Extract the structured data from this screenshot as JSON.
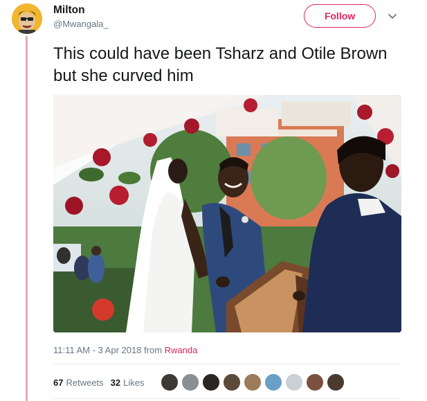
{
  "user": {
    "display_name": "Milton",
    "handle": "@Mwangala_"
  },
  "actions": {
    "follow_label": "Follow"
  },
  "tweet": {
    "text": "This could have been Tsharz and Otile Brown but she curved him",
    "timestamp": "11:11 AM - 3 Apr 2018 from ",
    "location": "Rwanda"
  },
  "stats": {
    "retweets_count": "67",
    "retweets_label": "Retweets",
    "likes_count": "32",
    "likes_label": "Likes"
  },
  "likers": [
    "#3d3a35",
    "#8a8f94",
    "#2a2623",
    "#5b4a3a",
    "#9c7a5a",
    "#6aa0c8",
    "#c9d0d6",
    "#7a5040",
    "#4a3b2e"
  ],
  "colors": {
    "accent": "#e0245e",
    "thread_line": "#e8a8ad",
    "secondary_text": "#657786"
  }
}
